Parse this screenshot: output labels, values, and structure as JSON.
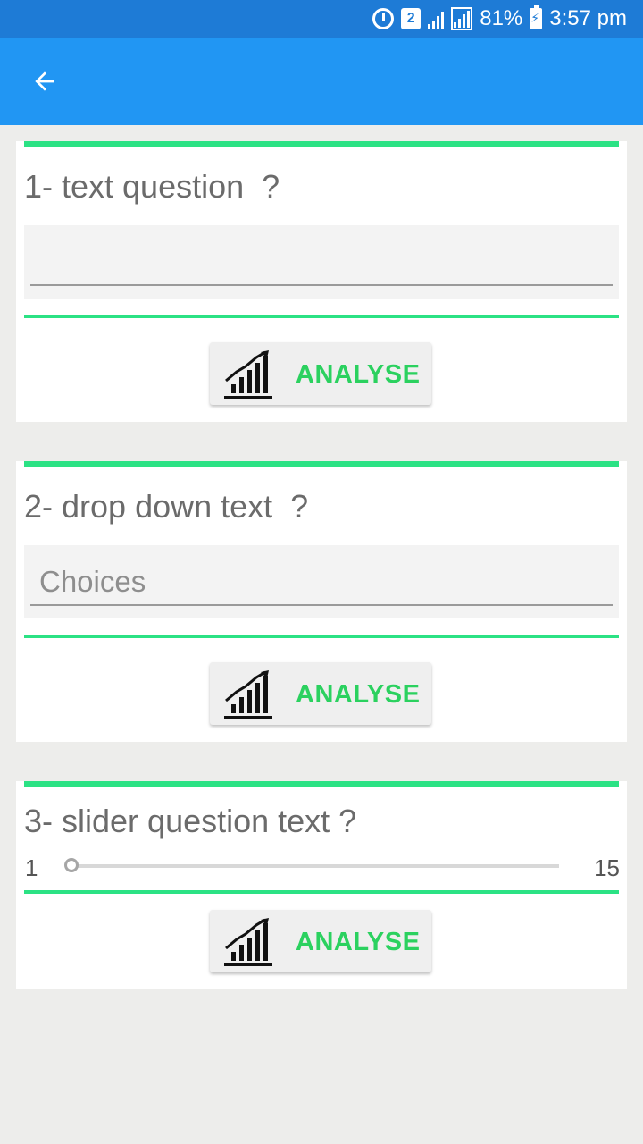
{
  "status_bar": {
    "sim_label": "2",
    "battery": "81%",
    "time": "3:57 pm"
  },
  "app_bar": {
    "back_icon": "arrow-back-icon"
  },
  "questions": [
    {
      "title": "1- text question  ?",
      "type": "text",
      "value": "",
      "button_label": "ANALYSE"
    },
    {
      "title": "2- drop down text  ?",
      "type": "dropdown",
      "placeholder": "Choices",
      "button_label": "ANALYSE"
    },
    {
      "title": "3- slider question text ?",
      "type": "slider",
      "min": "1",
      "max": "15",
      "value": 1,
      "button_label": "ANALYSE"
    }
  ],
  "colors": {
    "status_bar": "#1e7bd6",
    "app_bar": "#2196f3",
    "accent_line": "#2be284",
    "analyse_text": "#2bd15f",
    "background": "#ededeb"
  }
}
